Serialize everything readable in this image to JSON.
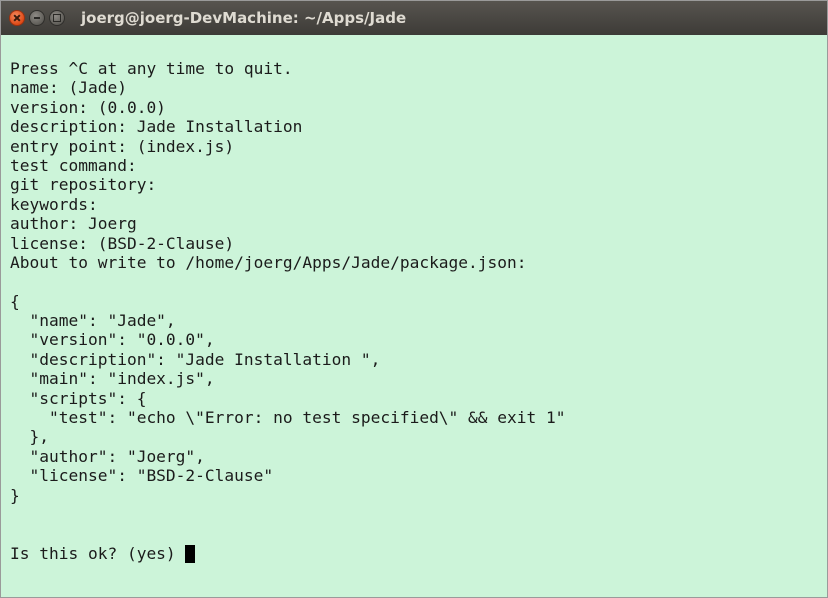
{
  "window": {
    "title": "joerg@joerg-DevMachine: ~/Apps/Jade"
  },
  "terminal": {
    "lines": [
      "Press ^C at any time to quit.",
      "name: (Jade)",
      "version: (0.0.0)",
      "description: Jade Installation",
      "entry point: (index.js)",
      "test command:",
      "git repository:",
      "keywords:",
      "author: Joerg",
      "license: (BSD-2-Clause)",
      "About to write to /home/joerg/Apps/Jade/package.json:",
      "",
      "{",
      "  \"name\": \"Jade\",",
      "  \"version\": \"0.0.0\",",
      "  \"description\": \"Jade Installation \",",
      "  \"main\": \"index.js\",",
      "  \"scripts\": {",
      "    \"test\": \"echo \\\"Error: no test specified\\\" && exit 1\"",
      "  },",
      "  \"author\": \"Joerg\",",
      "  \"license\": \"BSD-2-Clause\"",
      "}",
      "",
      "",
      "Is this ok? (yes) "
    ]
  }
}
